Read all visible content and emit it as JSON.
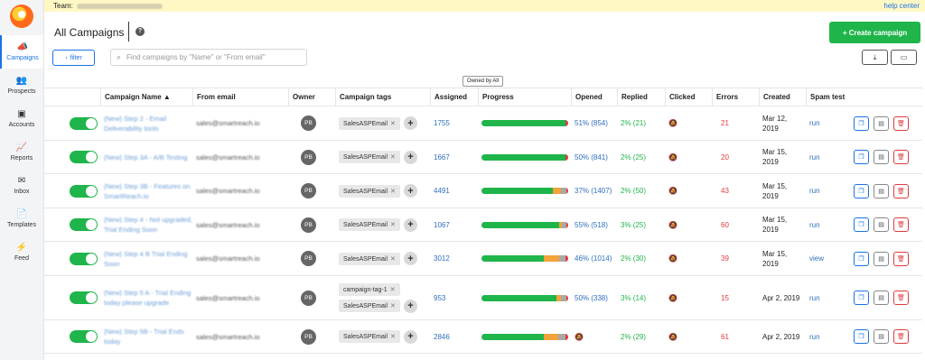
{
  "topbar": {
    "team_label": "Team:",
    "help_label": "help center"
  },
  "sidebar": {
    "items": [
      {
        "label": "Campaigns",
        "icon": "megaphone-icon",
        "glyph": "📣",
        "active": true
      },
      {
        "label": "Prospects",
        "icon": "people-icon",
        "glyph": "👥",
        "active": false
      },
      {
        "label": "Accounts",
        "icon": "building-icon",
        "glyph": "▣",
        "active": false
      },
      {
        "label": "Reports",
        "icon": "chart-icon",
        "glyph": "📈",
        "active": false
      },
      {
        "label": "Inbox",
        "icon": "envelope-icon",
        "glyph": "✉",
        "active": false
      },
      {
        "label": "Templates",
        "icon": "document-icon",
        "glyph": "📄",
        "active": false
      },
      {
        "label": "Feed",
        "icon": "bolt-icon",
        "glyph": "⚡",
        "active": false
      }
    ]
  },
  "header": {
    "title": "All Campaigns",
    "help_glyph": "?",
    "create_label": "+ Create campaign"
  },
  "toolbar": {
    "filter_label": "filter",
    "search_placeholder": "Find campaigns by \"Name\" or \"From email\"",
    "download_glyph": "⤓",
    "columns_glyph": "▭",
    "owned_by_label": "Owned by All"
  },
  "columns": [
    "Campaign Name ▲",
    "From email",
    "Owner",
    "Campaign tags",
    "Assigned",
    "Progress",
    "Opened",
    "Replied",
    "Clicked",
    "Errors",
    "Created",
    "Spam test"
  ],
  "colors": {
    "green": "#1fb54a",
    "orange": "#f2a33a",
    "gray": "#a9a9a9",
    "red": "#e03b3b",
    "blue": "#1a73e8"
  },
  "rows": [
    {
      "name": "(New) Step 2 - Email Deliverability tools",
      "email": "sales@smartreach.io",
      "owner": "PB",
      "tags": [
        "SalesASPEmail"
      ],
      "assigned": "1755",
      "progress": [
        0.97,
        0,
        0,
        0.03
      ],
      "opened": "51% (854)",
      "replied": "2% (21)",
      "clicked_icon": "bell-off-icon",
      "errors": "21",
      "created": "Mar 12, 2019",
      "spam": "run"
    },
    {
      "name": "(New) Step 3A - A/B Testing",
      "email": "sales@smartreach.io",
      "owner": "PB",
      "tags": [
        "SalesASPEmail"
      ],
      "assigned": "1667",
      "progress": [
        0.97,
        0,
        0,
        0.03
      ],
      "opened": "50% (841)",
      "replied": "2% (25)",
      "clicked_icon": "bell-off-icon",
      "errors": "20",
      "created": "Mar 15, 2019",
      "spam": "run"
    },
    {
      "name": "(New) Step 3B - Features on SmartReach.io",
      "email": "sales@smartreach.io",
      "owner": "PB",
      "tags": [
        "SalesASPEmail"
      ],
      "assigned": "4491",
      "progress": [
        0.82,
        0.1,
        0.06,
        0.02
      ],
      "opened": "37% (1407)",
      "replied": "2% (50)",
      "clicked_icon": "bell-off-icon",
      "errors": "43",
      "created": "Mar 15, 2019",
      "spam": "run"
    },
    {
      "name": "(New) Step 4 - Not upgraded, Trial Ending Soon",
      "email": "sales@smartreach.io",
      "owner": "PB",
      "tags": [
        "SalesASPEmail"
      ],
      "assigned": "1067",
      "progress": [
        0.9,
        0.03,
        0.05,
        0.02
      ],
      "opened": "55% (518)",
      "replied": "3% (25)",
      "clicked_icon": "bell-off-icon",
      "errors": "60",
      "created": "Mar 15, 2019",
      "spam": "run"
    },
    {
      "name": "(New) Step 4 B Trial Ending Soon",
      "email": "sales@smartreach.io",
      "owner": "PB",
      "tags": [
        "SalesASPEmail"
      ],
      "assigned": "3012",
      "progress": [
        0.72,
        0.18,
        0.07,
        0.03
      ],
      "opened": "46% (1014)",
      "replied": "2% (30)",
      "clicked_icon": "bell-off-icon",
      "errors": "39",
      "created": "Mar 15, 2019",
      "spam": "view"
    },
    {
      "name": "(New) Step 5 A - Trial Ending today please upgrade",
      "email": "sales@smartreach.io",
      "owner": "PB",
      "tags": [
        "campaign-tag-1",
        "SalesASPEmail"
      ],
      "assigned": "953",
      "progress": [
        0.86,
        0.06,
        0.06,
        0.02
      ],
      "opened": "50% (338)",
      "replied": "3% (14)",
      "clicked_icon": "bell-off-icon",
      "errors": "15",
      "created": "Apr 2, 2019",
      "spam": "run"
    },
    {
      "name": "(New) Step 5B - Trial Ends today",
      "email": "sales@smartreach.io",
      "owner": "PB",
      "tags": [
        "SalesASPEmail"
      ],
      "assigned": "2846",
      "progress": [
        0.72,
        0.17,
        0.08,
        0.03
      ],
      "opened_icon": "bell-off-icon",
      "replied": "2% (29)",
      "clicked_icon": "bell-off-icon",
      "errors": "61",
      "created": "Apr 2, 2019",
      "spam": "run"
    }
  ]
}
